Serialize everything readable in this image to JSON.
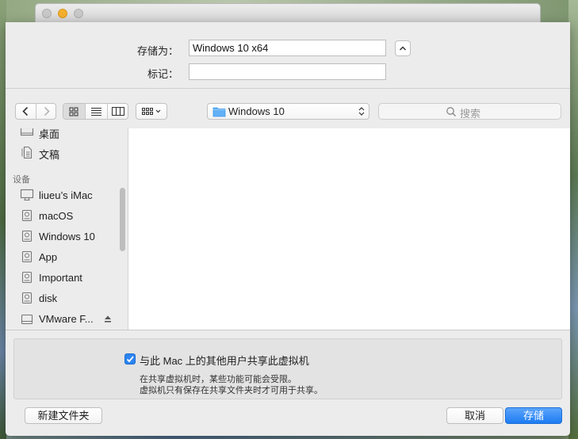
{
  "window": {
    "title": ""
  },
  "header": {
    "save_as_label": "存储为：",
    "save_as_value": "Windows 10 x64",
    "tags_label": "标记：",
    "tags_value": ""
  },
  "toolbar": {
    "location_popup": "Windows 10",
    "search_placeholder": "搜索"
  },
  "sidebar": {
    "items_top": [
      {
        "label": "桌面",
        "icon": "desktop-icon"
      },
      {
        "label": "文稿",
        "icon": "documents-icon"
      }
    ],
    "devices_header": "设备",
    "devices": [
      {
        "label": "liueu’s iMac",
        "icon": "imac-icon"
      },
      {
        "label": "macOS",
        "icon": "disk-icon"
      },
      {
        "label": "Windows 10",
        "icon": "disk-icon"
      },
      {
        "label": "App",
        "icon": "disk-icon"
      },
      {
        "label": "Important",
        "icon": "disk-icon"
      },
      {
        "label": "disk",
        "icon": "disk-icon"
      },
      {
        "label": "VMware F...",
        "icon": "external-drive-icon"
      }
    ]
  },
  "accessory": {
    "share_checkbox_label": "与此 Mac 上的其他用户共享此虚拟机",
    "share_checked": true,
    "note_line1": "在共享虚拟机时，某些功能可能会受限。",
    "note_line2": "虚拟机只有保存在共享文件夹时才可用于共享。"
  },
  "buttons": {
    "new_folder": "新建文件夹",
    "cancel": "取消",
    "save": "存储"
  },
  "colors": {
    "accent": "#1d7cf2",
    "window_bg": "#ececec"
  }
}
